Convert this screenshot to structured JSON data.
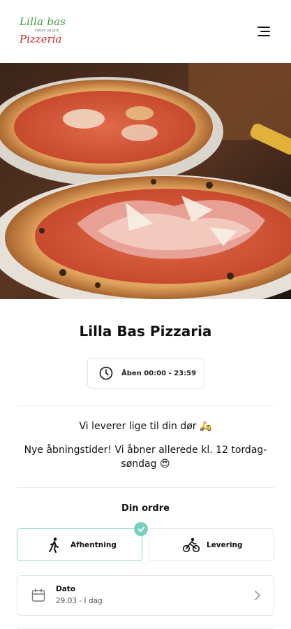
{
  "brand": {
    "logo_top": "Lilla bas",
    "logo_tagline": "Kebab og grill",
    "logo_bottom": "Pizzeria",
    "logo_green": "#3a9a3a",
    "logo_red": "#cc2b2b"
  },
  "header": {
    "menu_icon": "hamburger-menu-icon"
  },
  "hero": {
    "image": "pizza-photo"
  },
  "restaurant": {
    "name": "Lilla Bas Pizzaria",
    "hours_icon": "clock-icon",
    "hours": "Åben 00:00 - 23:59"
  },
  "messages": {
    "delivery": "Vi leverer lige til din dør 🛵",
    "notice": "Nye åbningstider! Vi åbner allerede kl. 12 tordag-søndag 😍"
  },
  "order": {
    "title": "Din ordre",
    "accent": "#7ccfc0",
    "options": [
      {
        "label": "Afhentning",
        "icon": "walking-person-icon",
        "selected": true
      },
      {
        "label": "Levering",
        "icon": "cyclist-icon",
        "selected": false
      }
    ],
    "date": {
      "icon": "calendar-icon",
      "label": "Dato",
      "value": "29.03 - I dag"
    }
  }
}
